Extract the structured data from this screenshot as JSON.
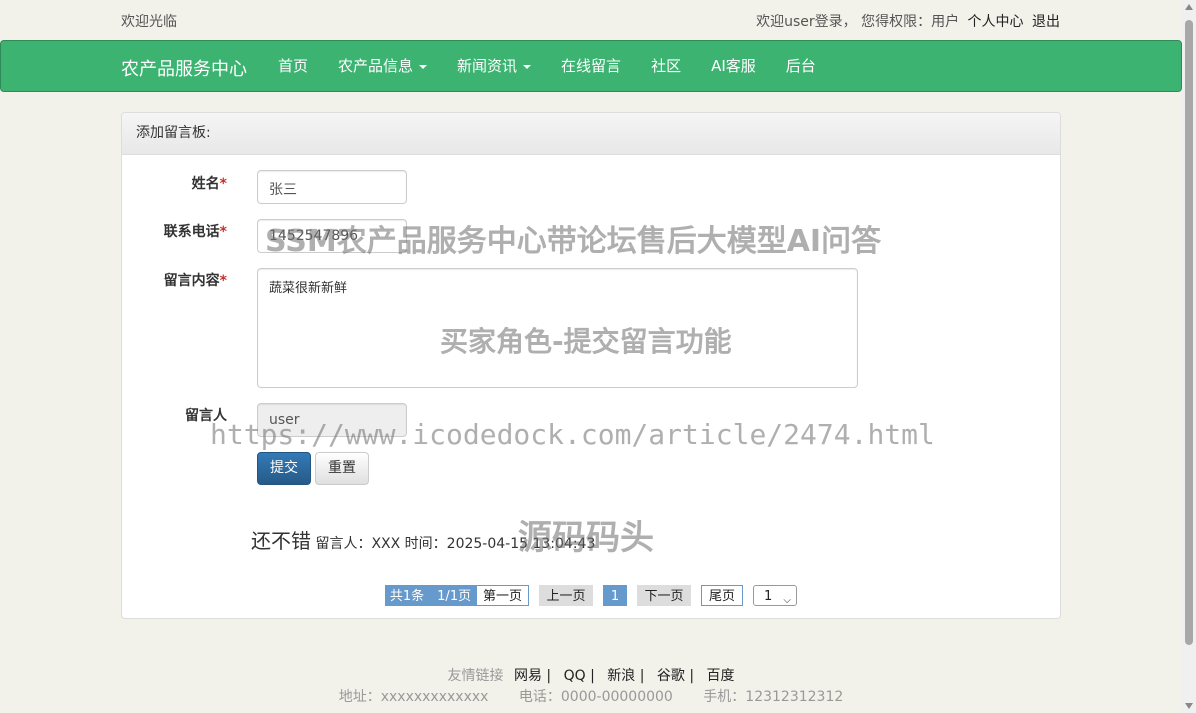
{
  "topbar": {
    "welcome": "欢迎光临",
    "user_info": "欢迎user登录， 您得权限：用户",
    "personal_center": "个人中心",
    "logout": "退出"
  },
  "nav": {
    "brand": "农产品服务中心",
    "items": [
      "首页",
      "农产品信息",
      "新闻资讯",
      "在线留言",
      "社区",
      "AI客服",
      "后台"
    ],
    "accent_color": "#3cb371"
  },
  "panel": {
    "heading": "添加留言板:"
  },
  "form": {
    "name_label": "姓名",
    "name_value": "张三",
    "phone_label": "联系电话",
    "phone_value": "1452547896",
    "content_label": "留言内容",
    "content_value": "蔬菜很新新鲜",
    "author_label": "留言人",
    "author_value": "user",
    "required_mark": "*",
    "submit": "提交",
    "reset": "重置"
  },
  "comments": [
    {
      "title": "还不错",
      "meta": "留言人：XXX 时间：2025-04-15 13:04:43"
    }
  ],
  "pagination": {
    "info": "共1条　1/1页",
    "first": "第一页",
    "prev": "上一页",
    "current": "1",
    "next": "下一页",
    "last": "尾页",
    "select_value": "1"
  },
  "footer": {
    "links_label": "友情链接",
    "links": [
      "网易 |",
      "QQ |",
      "新浪 |",
      "谷歌 |",
      "百度"
    ],
    "address": "地址：xxxxxxxxxxxxx",
    "phone": "电话：0000-00000000",
    "mobile": "手机：12312312312"
  },
  "watermarks": {
    "title": "SSM农产品服务中心带论坛售后大模型AI问答",
    "subtitle": "买家角色-提交留言功能",
    "url": "https://www.icodedock.com/article/2474.html",
    "brand": "源码码头"
  }
}
